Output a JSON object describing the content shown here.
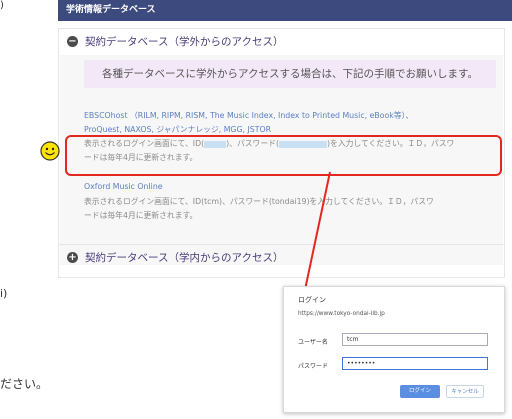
{
  "page": {
    "left_fragment_top": ")",
    "left_fragment_mid": "i)",
    "left_fragment_bottom": "ださい。"
  },
  "header": {
    "title": "学術情報データベース"
  },
  "section1": {
    "toggle": "−",
    "title": "契約データベース（学外からのアクセス）",
    "notice": "各種データベースに学外からアクセスする場合は、下記の手順でお願いします。",
    "entry1": {
      "link_line1": "EBSCOhost （RILM, RIPM, RISM, The Music Index, Index to Printed Music, eBook等）、",
      "link_line2": "ProQuest, NAXOS, ジャパンナレッジ, MGG, JSTOR",
      "text_a": "表示されるログイン画面にて、ID(",
      "text_b": ")、パスワード(",
      "text_c": ")を入力してください。ＩＤ，パスワ",
      "line2": "ードは毎年4月に更新されます。"
    },
    "entry2": {
      "link": "Oxford Music Online",
      "line1": "表示されるログイン画面にて、ID(tcm)、パスワード(tondai19)を入力してください。ＩＤ，パスワ",
      "line2": "ードは毎年4月に更新されます。"
    }
  },
  "section2": {
    "toggle": "+",
    "title": "契約データベース（学内からのアクセス）"
  },
  "dialog": {
    "title": "ログイン",
    "url": "https://www.tokyo-ondai-lib.jp",
    "username_label": "ユーザー名",
    "username_value": "tcm",
    "password_label": "パスワード",
    "password_value": "••••••••",
    "login_button": "ログイン",
    "cancel_button": "キャンセル"
  },
  "colors": {
    "header_bg": "#3d4a7e",
    "highlight": "#e4271f",
    "notice_bg": "#f3e8f7",
    "link": "#5a7fbf"
  }
}
